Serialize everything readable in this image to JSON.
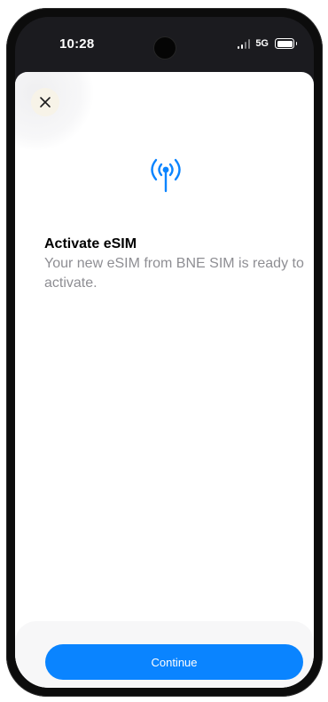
{
  "status_bar": {
    "time": "10:28",
    "network": "5G"
  },
  "sheet": {
    "title": "Activate eSIM",
    "subtitle": "Your new eSIM from BNE SIM is ready to activate.",
    "continue_label": "Continue",
    "icons": {
      "close": "close-icon",
      "hero": "antenna-icon"
    }
  },
  "colors": {
    "accent": "#0a84ff",
    "title": "#000000",
    "subtitle": "#8e8e93",
    "close_button_bg": "#f7f3e8"
  }
}
